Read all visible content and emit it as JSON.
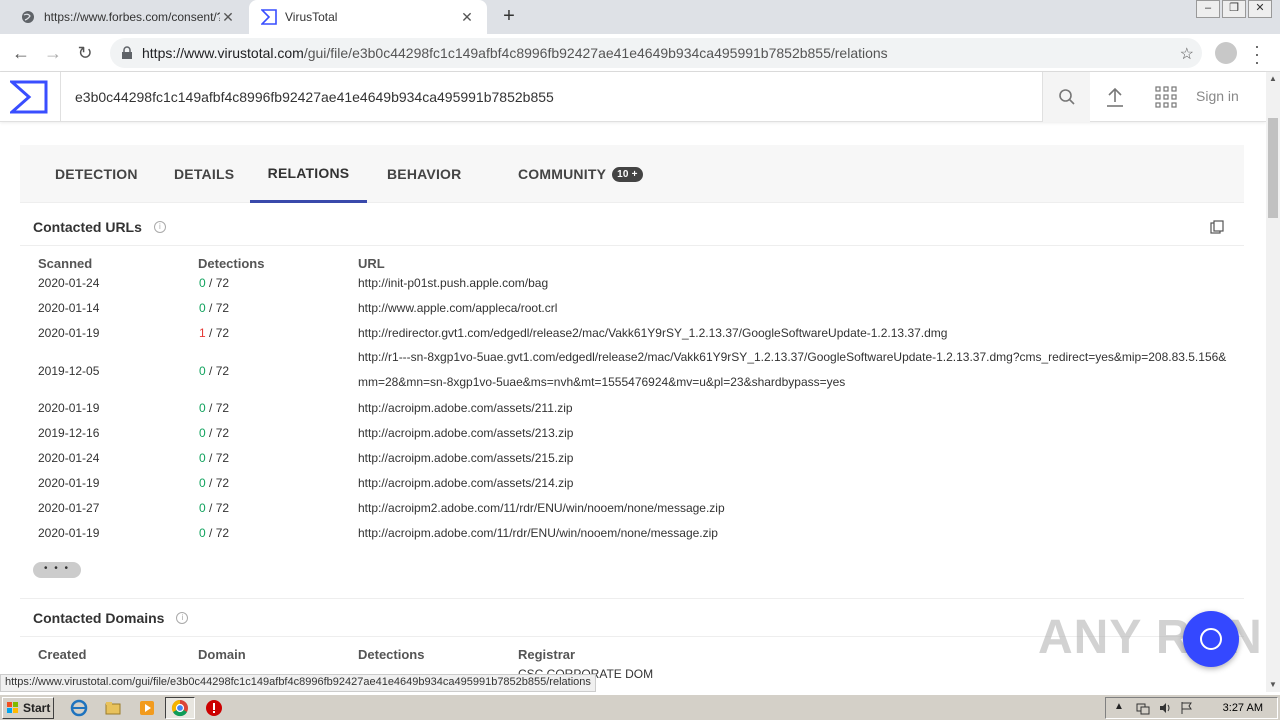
{
  "browser": {
    "tabs": [
      {
        "title": "https://www.forbes.com/consent/?t",
        "active": false
      },
      {
        "title": "VirusTotal",
        "active": true
      }
    ],
    "url_host": "https://www.virustotal.com",
    "url_path": "/gui/file/e3b0c44298fc1c149afbf4c8996fb92427ae41e4649b934ca495991b7852b855/relations"
  },
  "vt": {
    "search_value": "e3b0c44298fc1c149afbf4c8996fb92427ae41e4649b934ca495991b7852b855",
    "signin_label": "Sign in",
    "tabs": [
      "DETECTION",
      "DETAILS",
      "RELATIONS",
      "BEHAVIOR",
      "COMMUNITY"
    ],
    "community_badge": "10 +",
    "active_tab": "RELATIONS"
  },
  "contacted_urls": {
    "title": "Contacted URLs",
    "headers": {
      "scanned": "Scanned",
      "detections": "Detections",
      "url": "URL"
    },
    "rows": [
      {
        "scanned": "2020-01-24",
        "positives": "0",
        "total": " / 72",
        "url": "http://init-p01st.push.apple.com/bag"
      },
      {
        "scanned": "2020-01-14",
        "positives": "0",
        "total": " / 72",
        "url": "http://www.apple.com/appleca/root.crl"
      },
      {
        "scanned": "2020-01-19",
        "positives": "1",
        "total": " / 72",
        "url": "http://redirector.gvt1.com/edgedl/release2/mac/Vakk61Y9rSY_1.2.13.37/GoogleSoftwareUpdate-1.2.13.37.dmg"
      },
      {
        "scanned": "2019-12-05",
        "positives": "0",
        "total": " / 72",
        "url": "http://r1---sn-8xgp1vo-5uae.gvt1.com/edgedl/release2/mac/Vakk61Y9rSY_1.2.13.37/GoogleSoftwareUpdate-1.2.13.37.dmg?cms_redirect=yes&mip=208.83.5.156&mm=28&mn=sn-8xgp1vo-5uae&ms=nvh&mt=1555476924&mv=u&pl=23&shardbypass=yes"
      },
      {
        "scanned": "2020-01-19",
        "positives": "0",
        "total": " / 72",
        "url": "http://acroipm.adobe.com/assets/211.zip"
      },
      {
        "scanned": "2019-12-16",
        "positives": "0",
        "total": " / 72",
        "url": "http://acroipm.adobe.com/assets/213.zip"
      },
      {
        "scanned": "2020-01-24",
        "positives": "0",
        "total": " / 72",
        "url": "http://acroipm.adobe.com/assets/215.zip"
      },
      {
        "scanned": "2020-01-19",
        "positives": "0",
        "total": " / 72",
        "url": "http://acroipm.adobe.com/assets/214.zip"
      },
      {
        "scanned": "2020-01-27",
        "positives": "0",
        "total": " / 72",
        "url": "http://acroipm2.adobe.com/11/rdr/ENU/win/nooem/none/message.zip"
      },
      {
        "scanned": "2020-01-19",
        "positives": "0",
        "total": " / 72",
        "url": "http://acroipm.adobe.com/11/rdr/ENU/win/nooem/none/message.zip"
      }
    ],
    "more_label": "• • •"
  },
  "contacted_domains": {
    "title": "Contacted Domains",
    "headers": {
      "created": "Created",
      "domain": "Domain",
      "detections": "Detections",
      "registrar": "Registrar"
    },
    "first_registrar": "CSC CORPORATE DOM"
  },
  "status_bar": "https://www.virustotal.com/gui/file/e3b0c44298fc1c149afbf4c8996fb92427ae41e4649b934ca495991b7852b855/relations",
  "watermark": "ANY RUN",
  "taskbar": {
    "start_label": "Start",
    "clock": "3:27 AM"
  },
  "colors": {
    "accent": "#3949ab",
    "clean": "#12a35e",
    "malicious": "#e53935",
    "fab": "#3448ff"
  }
}
